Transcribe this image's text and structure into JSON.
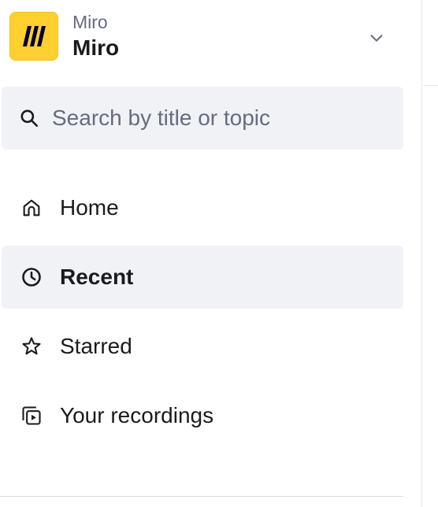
{
  "workspace": {
    "org": "Miro",
    "name": "Miro"
  },
  "search": {
    "placeholder": "Search by title or topic",
    "value": ""
  },
  "nav": {
    "items": [
      {
        "label": "Home",
        "icon": "home-icon",
        "active": false
      },
      {
        "label": "Recent",
        "icon": "clock-icon",
        "active": true
      },
      {
        "label": "Starred",
        "icon": "star-icon",
        "active": false
      },
      {
        "label": "Your recordings",
        "icon": "recordings-icon",
        "active": false
      }
    ]
  },
  "colors": {
    "logo_bg": "#ffd02f",
    "active_bg": "#f1f2f5",
    "muted_text": "#656b81",
    "text": "#1a1b1f"
  }
}
